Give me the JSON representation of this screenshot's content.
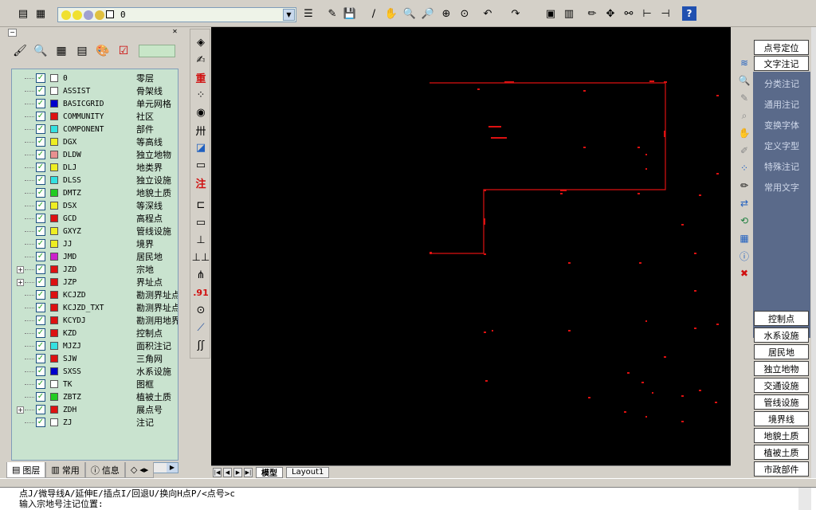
{
  "toolbar": {
    "layer_combo_value": "0",
    "icons": [
      "layer-manager-icon",
      "layer-previous-icon",
      "matchprop-icon",
      "save-icon",
      "pencil-icon",
      "pan-realtime-icon",
      "zoom-realtime-icon",
      "zoom-window-icon",
      "zoom-in-icon",
      "zoom-extents-icon",
      "undo-icon",
      "redo-icon",
      "properties-icon",
      "table-icon",
      "draw-icon",
      "move-icon",
      "link-icon",
      "dimension-icon",
      "dim-linear-icon",
      "help-icon"
    ]
  },
  "layers": [
    {
      "name": "0",
      "desc": "零层",
      "color": "#ffffff",
      "expand": false
    },
    {
      "name": "ASSIST",
      "desc": "骨架线",
      "color": "#ffffff",
      "expand": false
    },
    {
      "name": "BASICGRID",
      "desc": "单元网格",
      "color": "#0000cc",
      "expand": false
    },
    {
      "name": "COMMUNITY",
      "desc": "社区",
      "color": "#dd1111",
      "expand": false
    },
    {
      "name": "COMPONENT",
      "desc": "部件",
      "color": "#33e0e0",
      "expand": false
    },
    {
      "name": "DGX",
      "desc": "等高线",
      "color": "#eeee22",
      "expand": false
    },
    {
      "name": "DLDW",
      "desc": "独立地物",
      "color": "#e89090",
      "expand": false
    },
    {
      "name": "DLJ",
      "desc": "地类界",
      "color": "#eeee22",
      "expand": false
    },
    {
      "name": "DLSS",
      "desc": "独立设施",
      "color": "#33e0e0",
      "expand": false
    },
    {
      "name": "DMTZ",
      "desc": "地貌土质",
      "color": "#22cc22",
      "expand": false
    },
    {
      "name": "DSX",
      "desc": "等深线",
      "color": "#eeee22",
      "expand": false
    },
    {
      "name": "GCD",
      "desc": "高程点",
      "color": "#dd1111",
      "expand": false
    },
    {
      "name": "GXYZ",
      "desc": "管线设施",
      "color": "#eeee22",
      "expand": false
    },
    {
      "name": "JJ",
      "desc": "境界",
      "color": "#eeee22",
      "expand": false
    },
    {
      "name": "JMD",
      "desc": "居民地",
      "color": "#cc22cc",
      "expand": false
    },
    {
      "name": "JZD",
      "desc": "宗地",
      "color": "#dd1111",
      "expand": true
    },
    {
      "name": "JZP",
      "desc": "界址点",
      "color": "#dd1111",
      "expand": true
    },
    {
      "name": "KCJZD",
      "desc": "勘测界址点",
      "color": "#dd1111",
      "expand": false
    },
    {
      "name": "KCJZD_TXT",
      "desc": "勘测界址点",
      "color": "#dd1111",
      "expand": false
    },
    {
      "name": "KCYDJ",
      "desc": "勘测用地界",
      "color": "#dd1111",
      "expand": false
    },
    {
      "name": "KZD",
      "desc": "控制点",
      "color": "#dd1111",
      "expand": false
    },
    {
      "name": "MJZJ",
      "desc": "面积注记",
      "color": "#33e0e0",
      "expand": false
    },
    {
      "name": "SJW",
      "desc": "三角网",
      "color": "#dd1111",
      "expand": false
    },
    {
      "name": "SXSS",
      "desc": "水系设施",
      "color": "#0000cc",
      "expand": false
    },
    {
      "name": "TK",
      "desc": "图框",
      "color": "#ffffff",
      "expand": false
    },
    {
      "name": "ZBTZ",
      "desc": "植被土质",
      "color": "#22cc22",
      "expand": false
    },
    {
      "name": "ZDH",
      "desc": "展点号",
      "color": "#dd1111",
      "expand": true
    },
    {
      "name": "ZJ",
      "desc": "注记",
      "color": "#ffffff",
      "expand": false
    }
  ],
  "panel_tabs": [
    "图层",
    "常用",
    "信息"
  ],
  "draw_toolbar": {
    "heavy_label": "重",
    "note_label": "注",
    "decimal_label": ".91"
  },
  "layout_tabs": [
    "模型",
    "Layout1"
  ],
  "right_panel": {
    "top_buttons": [
      "点号定位",
      "文字注记"
    ],
    "menu_items": [
      "分类注记",
      "通用注记",
      "变换字体",
      "定义字型",
      "特殊注记",
      "常用文字"
    ],
    "bottom_buttons": [
      "控制点",
      "水系设施",
      "居民地",
      "独立地物",
      "交通设施",
      "管线设施",
      "境界线",
      "地貌土质",
      "植被土质",
      "市政部件"
    ]
  },
  "command_line": {
    "line1": "点J/微导线A/延伸E/插点I/回退U/换向H点P/<点号>c",
    "line2": "输入宗地号注记位置:"
  },
  "colors": {
    "canvas_bg": "#000000",
    "drawing_red": "#dd1111",
    "panel_green": "#c9e3cf",
    "menu_bg": "#5a6a8a"
  }
}
